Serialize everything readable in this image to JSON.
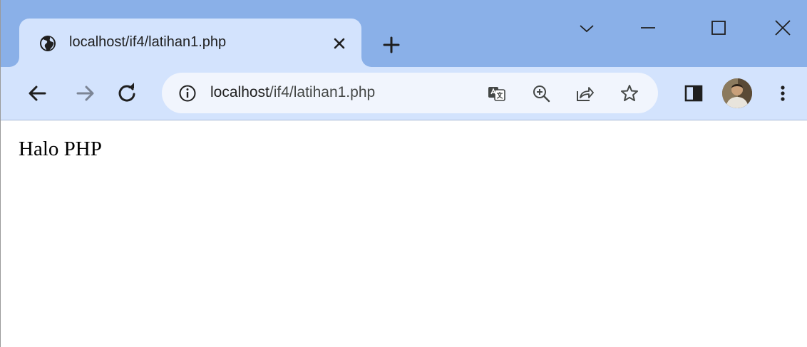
{
  "tab": {
    "title": "localhost/if4/latihan1.php",
    "favicon": "globe-icon"
  },
  "address_bar": {
    "host": "localhost",
    "path": "/if4/latihan1.php",
    "site_info_icon": "info-icon"
  },
  "page": {
    "text": "Halo PHP"
  },
  "colors": {
    "tabstrip": "#8ab0e8",
    "toolbar": "#d3e3fd",
    "omnibox": "#f1f5fd"
  }
}
